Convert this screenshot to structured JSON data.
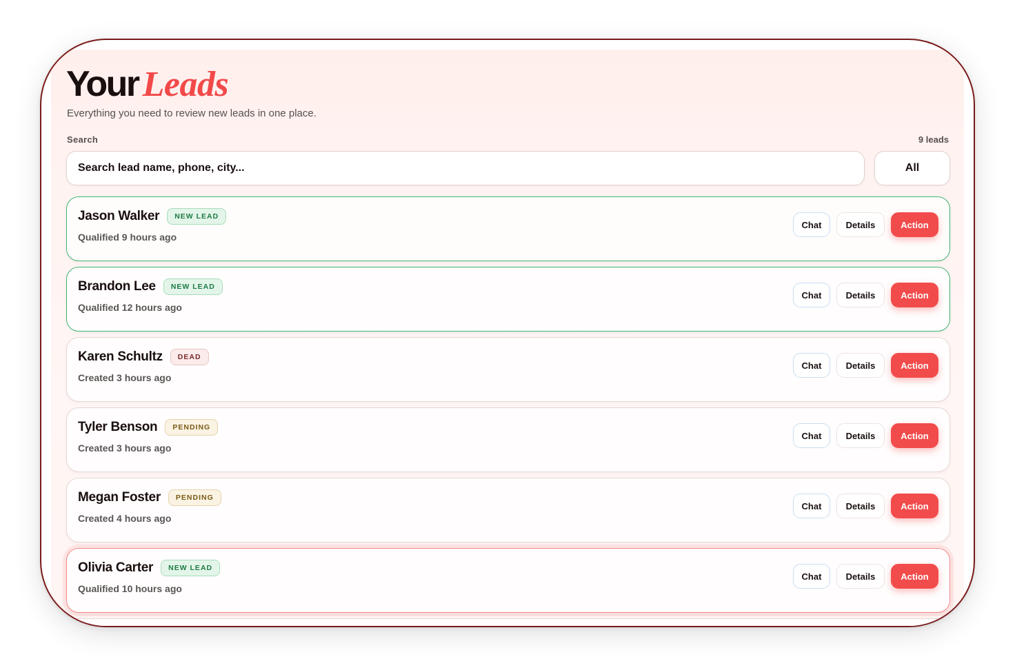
{
  "header": {
    "title_plain": "Your",
    "title_accent": "Leads",
    "subtitle": "Everything you need to review new leads in one place."
  },
  "search": {
    "label": "Search",
    "placeholder": "Search lead name, phone, city...",
    "count_label": "9 leads",
    "filter_label": "All"
  },
  "actions": {
    "chat_label": "Chat",
    "details_label": "Details",
    "action_label": "Action"
  },
  "leads": [
    {
      "name": "Jason Walker",
      "status": "NEW LEAD",
      "status_type": "new",
      "meta": "Qualified 9 hours ago",
      "highlight": "green"
    },
    {
      "name": "Brandon Lee",
      "status": "NEW LEAD",
      "status_type": "new",
      "meta": "Qualified 12 hours ago",
      "highlight": "green"
    },
    {
      "name": "Karen Schultz",
      "status": "DEAD",
      "status_type": "dead",
      "meta": "Created 3 hours ago",
      "highlight": "none"
    },
    {
      "name": "Tyler Benson",
      "status": "PENDING",
      "status_type": "pending",
      "meta": "Created 3 hours ago",
      "highlight": "none"
    },
    {
      "name": "Megan Foster",
      "status": "PENDING",
      "status_type": "pending",
      "meta": "Created 4 hours ago",
      "highlight": "none"
    },
    {
      "name": "Olivia Carter",
      "status": "NEW LEAD",
      "status_type": "new",
      "meta": "Qualified 10 hours ago",
      "highlight": "red"
    }
  ],
  "colors": {
    "accent": "#f24b4b",
    "new_badge": "#1e7a44",
    "dead_badge": "#7a2a2a",
    "pending_badge": "#7a5a14",
    "highlight_green": "#3fb46f",
    "highlight_red": "#f08a8a"
  }
}
